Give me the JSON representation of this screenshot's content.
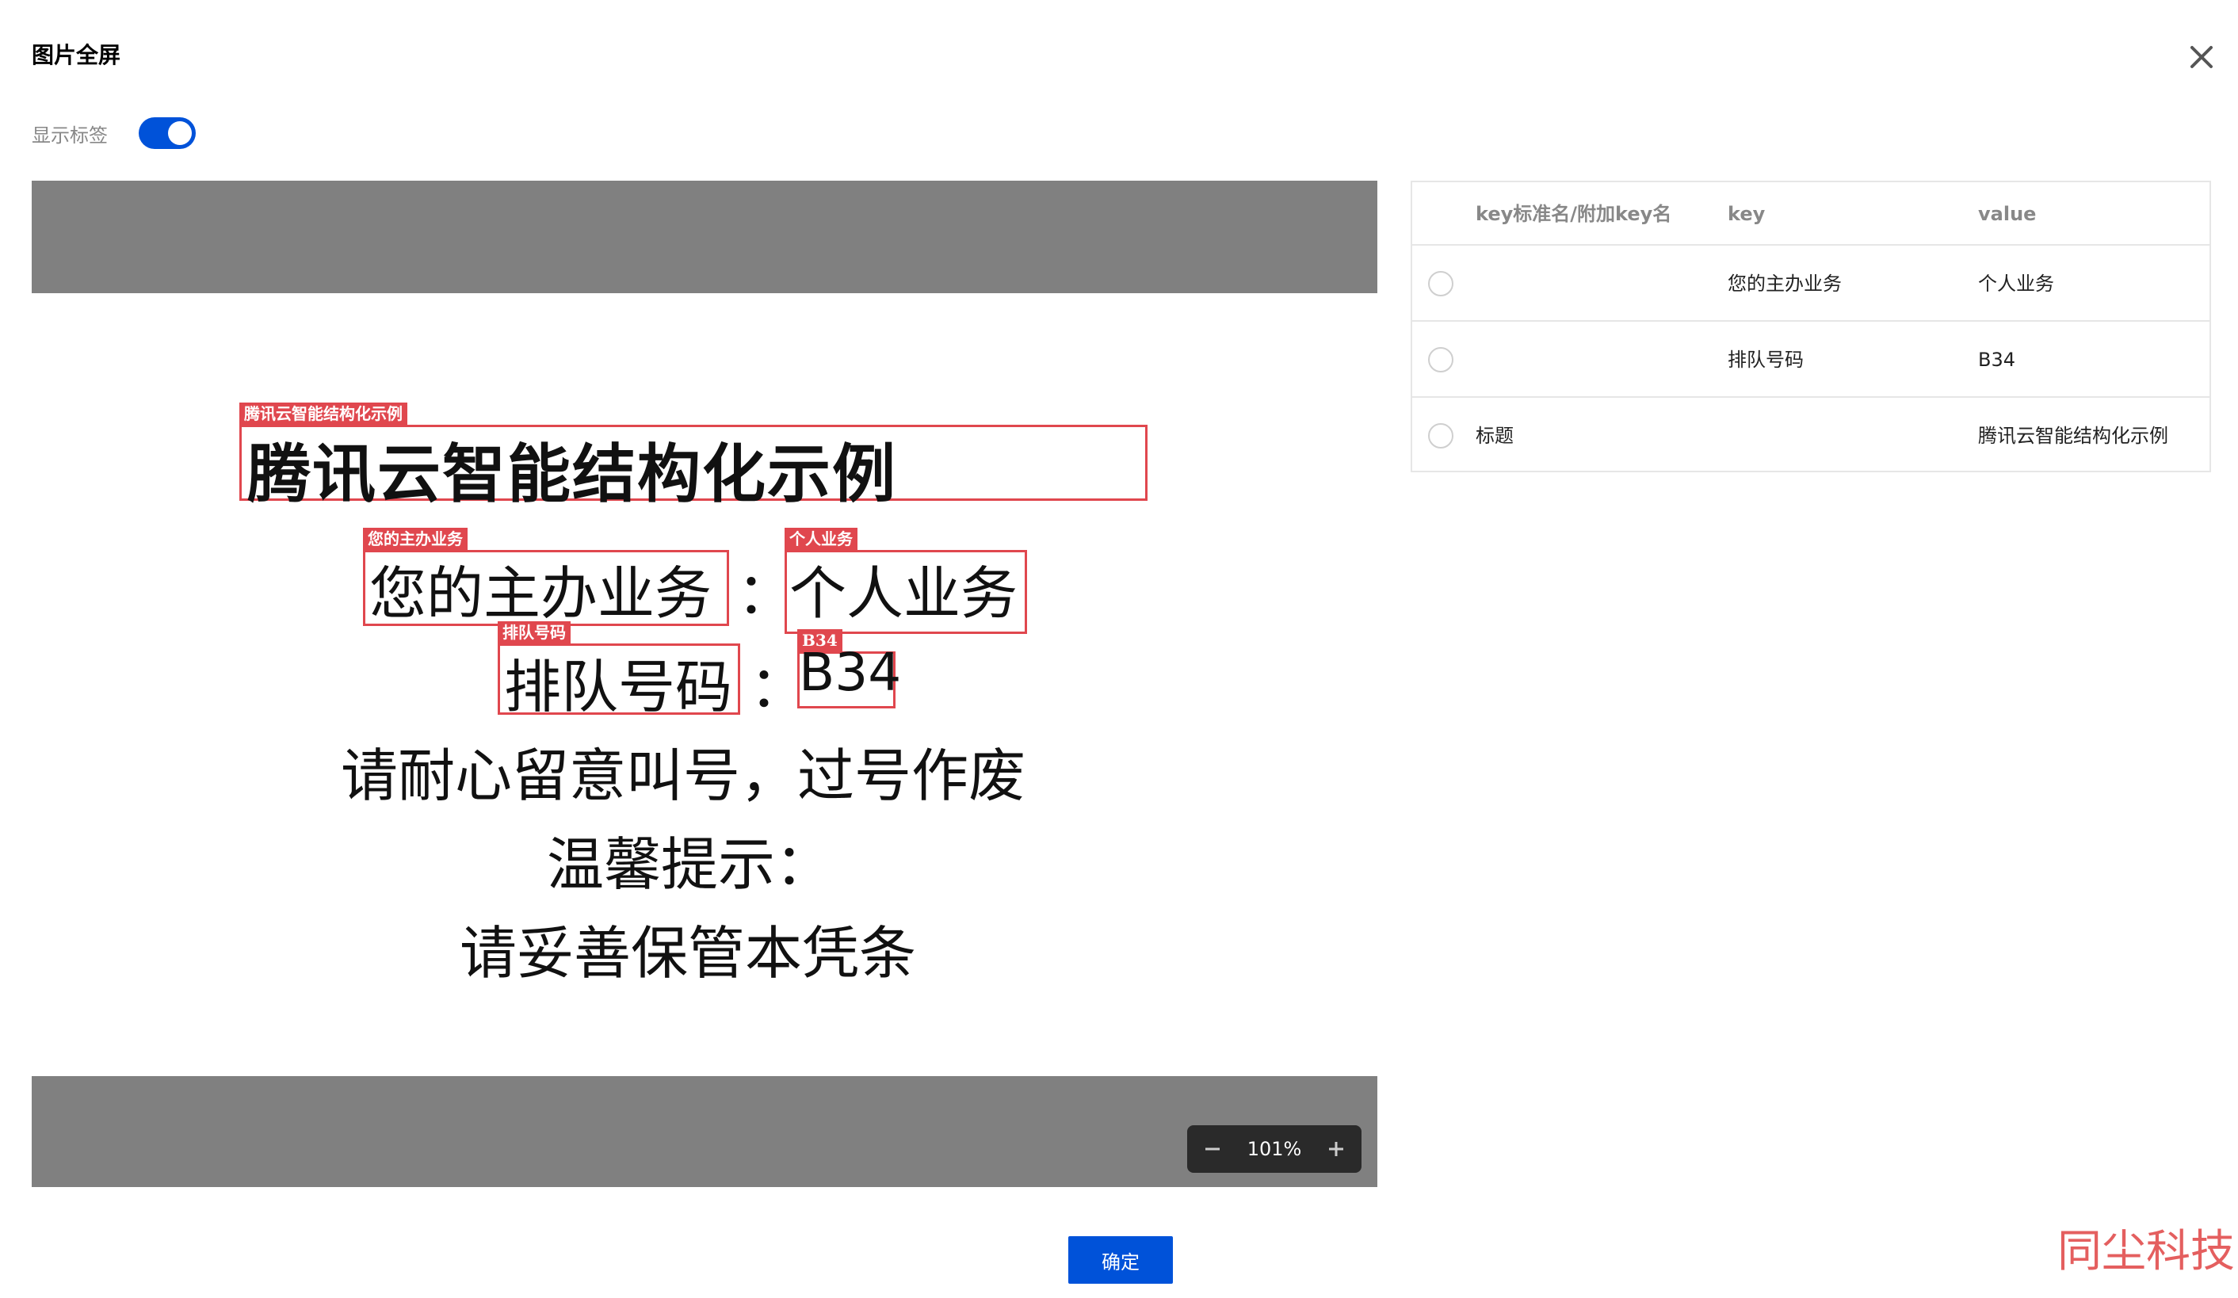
{
  "dialog": {
    "title": "图片全屏",
    "close_icon": "close-icon",
    "confirm_label": "确定"
  },
  "label_toggle": {
    "label": "显示标签",
    "enabled": true,
    "accent": "#0052d9"
  },
  "document_image": {
    "lines": {
      "title": "腾讯云智能结构化示例",
      "line1_key": "您的主办业务",
      "colon": "：",
      "line1_value": "个人业务",
      "line2_key": "排队号码",
      "line2_value": "B34",
      "line3": "请耐心留意叫号，过号作废",
      "line4": "温馨提示：",
      "line5": "请妥善保管本凭条"
    },
    "tags": {
      "title": "腾讯云智能结构化示例",
      "line1_key": "您的主办业务",
      "line1_value": "个人业务",
      "line2_key": "排队号码",
      "line2_value": "B34"
    },
    "box_color": "#e0474e"
  },
  "zoom": {
    "value": "101%",
    "minus_icon": "minus-icon",
    "plus_icon": "plus-icon"
  },
  "kv_table": {
    "columns": [
      "key标准名/附加key名",
      "key",
      "value"
    ],
    "rows": [
      {
        "std_name": "",
        "key": "您的主办业务",
        "value": "个人业务"
      },
      {
        "std_name": "",
        "key": "排队号码",
        "value": "B34"
      },
      {
        "std_name": "标题",
        "key": "",
        "value": "腾讯云智能结构化示例"
      }
    ]
  },
  "watermark": "同尘科技"
}
